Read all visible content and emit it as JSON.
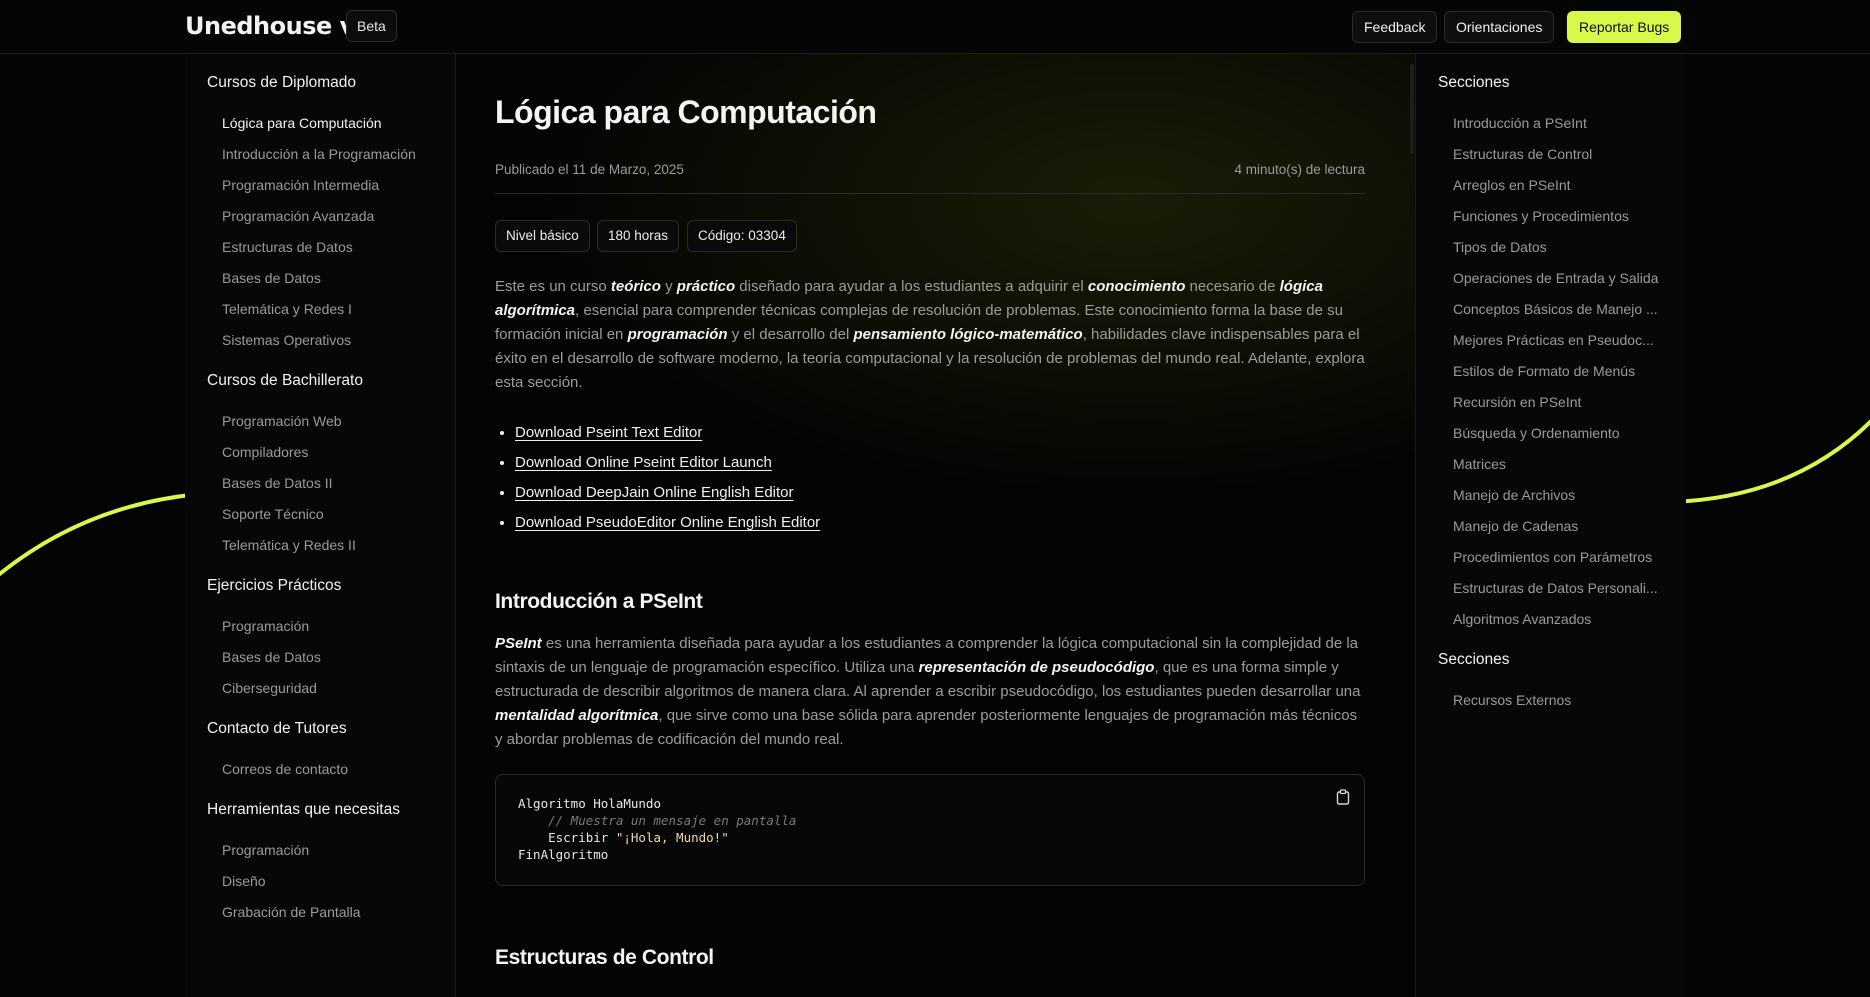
{
  "header": {
    "logo": "Unedhouse v1.0",
    "badge": "Beta",
    "buttons": [
      "Feedback",
      "Orientaciones",
      "Reportar Bugs"
    ]
  },
  "left_sidebar": {
    "groups": [
      {
        "title": "Cursos de Diplomado",
        "items": [
          "Lógica para Computación",
          "Introducción a la Programación",
          "Programación Intermedia",
          "Programación Avanzada",
          "Estructuras de Datos",
          "Bases de Datos",
          "Telemática y Redes I",
          "Sistemas Operativos"
        ]
      },
      {
        "title": "Cursos de Bachillerato",
        "items": [
          "Programación Web",
          "Compiladores",
          "Bases de Datos II",
          "Soporte Técnico",
          "Telemática y Redes II"
        ]
      },
      {
        "title": "Ejercicios Prácticos",
        "items": [
          "Programación",
          "Bases de Datos",
          "Ciberseguridad"
        ]
      },
      {
        "title": "Contacto de Tutores",
        "items": [
          "Correos de contacto"
        ]
      },
      {
        "title": "Herramientas que necesitas",
        "items": [
          "Programación",
          "Diseño",
          "Grabación de Pantalla"
        ]
      }
    ]
  },
  "main": {
    "title": "Lógica para Computación",
    "published": "Publicado el 11 de Marzo, 2025",
    "reading_time": "4 minuto(s) de lectura",
    "tags": [
      "Nivel básico",
      "180 horas",
      "Código: 03304"
    ],
    "intro": {
      "t1": "Este es un curso ",
      "b1": "teórico",
      "t2": " y ",
      "b2": "práctico",
      "t3": " diseñado para ayudar a los estudiantes a adquirir el ",
      "b3": "conocimiento",
      "t4": " necesario de ",
      "b4": "lógica algorítmica",
      "t5": ", esencial para comprender técnicas complejas de resolución de problemas. Este conocimiento forma la base de su formación inicial en ",
      "b5": "programación",
      "t6": " y el desarrollo del ",
      "b6": "pensamiento lógico-matemático",
      "t7": ", habilidades clave indispensables para el éxito en el desarrollo de software moderno, la teoría computacional y la resolución de problemas del mundo real. Adelante, explora esta sección."
    },
    "links": [
      "Download Pseint Text Editor",
      "Download Online Pseint Editor Launch",
      "Download DeepJain Online English Editor",
      "Download PseudoEditor Online English Editor"
    ],
    "section1": {
      "heading": "Introducción a PSeInt",
      "b1": "PSeInt",
      "t1": " es una herramienta diseñada para ayudar a los estudiantes a comprender la lógica computacional sin la complejidad de la sintaxis de un lenguaje de programación específico. Utiliza una ",
      "b2": "representación de pseudocódigo",
      "t2": ", que es una forma simple y estructurada de describir algoritmos de manera clara. Al aprender a escribir pseudocódigo, los estudiantes pueden desarrollar una ",
      "b3": "mentalidad algorítmica",
      "t3": ", que sirve como una base sólida para aprender posteriormente lenguajes de programación más técnicos y abordar problemas de codificación del mundo real."
    },
    "code": {
      "line1": "Algoritmo HolaMundo",
      "line2_comment": "    // Muestra un mensaje en pantalla",
      "line3_keyword": "    Escribir ",
      "line3_string": "\"¡Hola, Mundo!\"",
      "line4": "FinAlgoritmo"
    },
    "section2": {
      "heading": "Estructuras de Control"
    }
  },
  "right_sidebar": {
    "groups": [
      {
        "title": "Secciones",
        "items": [
          "Introducción a PSeInt",
          "Estructuras de Control",
          "Arreglos en PSeInt",
          "Funciones y Procedimientos",
          "Tipos de Datos",
          "Operaciones de Entrada y Salida",
          "Conceptos Básicos de Manejo ...",
          "Mejores Prácticas en Pseudoc...",
          "Estilos de Formato de Menús",
          "Recursión en PSeInt",
          "Búsqueda y Ordenamiento",
          "Matrices",
          "Manejo de Archivos",
          "Manejo de Cadenas",
          "Procedimientos con Parámetros",
          "Estructuras de Datos Personali...",
          "Algoritmos Avanzados"
        ]
      },
      {
        "title": "Secciones",
        "items": [
          "Recursos Externos"
        ]
      }
    ]
  },
  "colors": {
    "accent": "#d9f94a",
    "background": "#040404",
    "muted_text": "#9c9c9c"
  }
}
